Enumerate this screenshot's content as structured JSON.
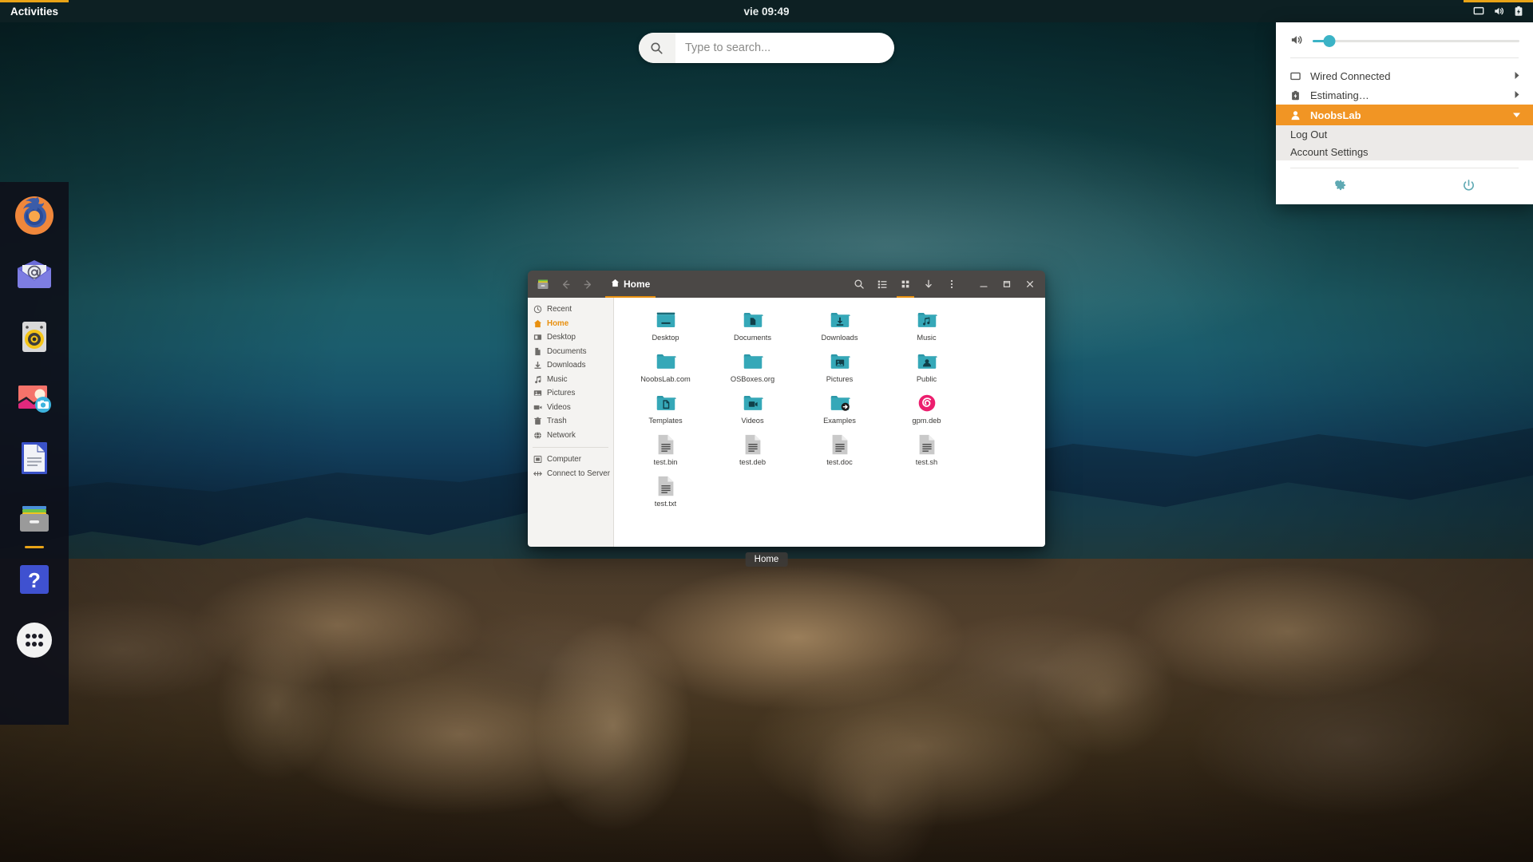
{
  "topbar": {
    "activities_label": "Activities",
    "clock": "vie 09:49",
    "status_icons": [
      "display-icon",
      "volume-icon",
      "battery-icon"
    ]
  },
  "search": {
    "placeholder": "Type to search...",
    "value": "",
    "icon": "search-icon"
  },
  "dock": {
    "items": [
      {
        "name": "firefox",
        "label": "Firefox",
        "running": false
      },
      {
        "name": "thunderbird",
        "label": "Thunderbird Mail",
        "running": false
      },
      {
        "name": "rhythmbox",
        "label": "Rhythmbox",
        "running": false
      },
      {
        "name": "shotwell",
        "label": "Shotwell Photo Manager",
        "running": false
      },
      {
        "name": "libreoffice-writer",
        "label": "LibreOffice Writer",
        "running": false
      },
      {
        "name": "files",
        "label": "Files",
        "running": true
      },
      {
        "name": "help",
        "label": "Help",
        "running": false
      },
      {
        "name": "show-applications",
        "label": "Show Applications",
        "running": false
      }
    ]
  },
  "filemanager": {
    "title": "Home",
    "breadcrumb": "Home",
    "tooltip": "Home",
    "header_buttons": [
      {
        "name": "back",
        "icon": "arrow-left-icon",
        "disabled": true
      },
      {
        "name": "forward",
        "icon": "arrow-right-icon",
        "disabled": true
      }
    ],
    "action_buttons": [
      {
        "name": "search",
        "icon": "search-icon",
        "active": false
      },
      {
        "name": "list-view",
        "icon": "list-view-icon",
        "active": false
      },
      {
        "name": "grid-view",
        "icon": "grid-view-icon",
        "active": true
      },
      {
        "name": "downloads",
        "icon": "arrow-down-icon",
        "active": false
      },
      {
        "name": "menu",
        "icon": "kebab-menu-icon",
        "active": false
      }
    ],
    "window_controls": [
      {
        "name": "minimize",
        "icon": "minimize-icon"
      },
      {
        "name": "maximize",
        "icon": "maximize-icon"
      },
      {
        "name": "close",
        "icon": "close-icon"
      }
    ],
    "sidebar": {
      "places": [
        {
          "label": "Recent",
          "icon": "clock-icon",
          "selected": false
        },
        {
          "label": "Home",
          "icon": "home-icon",
          "selected": true
        },
        {
          "label": "Desktop",
          "icon": "desktop-icon",
          "selected": false
        },
        {
          "label": "Documents",
          "icon": "document-icon",
          "selected": false
        },
        {
          "label": "Downloads",
          "icon": "download-icon",
          "selected": false
        },
        {
          "label": "Music",
          "icon": "music-icon",
          "selected": false
        },
        {
          "label": "Pictures",
          "icon": "picture-icon",
          "selected": false
        },
        {
          "label": "Videos",
          "icon": "video-icon",
          "selected": false
        },
        {
          "label": "Trash",
          "icon": "trash-icon",
          "selected": false
        },
        {
          "label": "Network",
          "icon": "network-icon",
          "selected": false
        }
      ],
      "devices": [
        {
          "label": "Computer",
          "icon": "computer-icon"
        },
        {
          "label": "Connect to Server",
          "icon": "connect-server-icon"
        }
      ]
    },
    "files": [
      {
        "label": "Desktop",
        "type": "folder",
        "glyph": "desktop"
      },
      {
        "label": "Documents",
        "type": "folder",
        "glyph": "document"
      },
      {
        "label": "Downloads",
        "type": "folder",
        "glyph": "download"
      },
      {
        "label": "Music",
        "type": "folder",
        "glyph": "music"
      },
      {
        "label": "NoobsLab.com",
        "type": "folder",
        "glyph": "none"
      },
      {
        "label": "OSBoxes.org",
        "type": "folder",
        "glyph": "none"
      },
      {
        "label": "Pictures",
        "type": "folder",
        "glyph": "picture"
      },
      {
        "label": "Public",
        "type": "folder",
        "glyph": "person"
      },
      {
        "label": "Templates",
        "type": "folder",
        "glyph": "template"
      },
      {
        "label": "Videos",
        "type": "folder",
        "glyph": "video"
      },
      {
        "label": "Examples",
        "type": "folder-link",
        "glyph": "none"
      },
      {
        "label": "gpm.deb",
        "type": "debian",
        "glyph": "none"
      },
      {
        "label": "test.bin",
        "type": "file",
        "glyph": "none"
      },
      {
        "label": "test.deb",
        "type": "file",
        "glyph": "none"
      },
      {
        "label": "test.doc",
        "type": "file",
        "glyph": "none"
      },
      {
        "label": "test.sh",
        "type": "file",
        "glyph": "none"
      },
      {
        "label": "test.txt",
        "type": "file",
        "glyph": "none"
      }
    ]
  },
  "system_menu": {
    "volume": {
      "icon": "volume-icon",
      "value": 8
    },
    "rows": [
      {
        "label": "Wired Connected",
        "icon": "wired-icon",
        "expand": true,
        "highlight": false
      },
      {
        "label": "Estimating…",
        "icon": "battery-icon",
        "expand": true,
        "highlight": false
      },
      {
        "label": "NoobsLab",
        "icon": "user-icon",
        "expand": true,
        "highlight": true
      }
    ],
    "submenu": [
      {
        "label": "Log Out"
      },
      {
        "label": "Account Settings"
      }
    ],
    "footer": [
      {
        "name": "settings",
        "icon": "gear-icon"
      },
      {
        "name": "power",
        "icon": "power-icon"
      }
    ]
  },
  "colors": {
    "accent_orange": "#e8a317",
    "highlight_orange": "#f19524",
    "teal": "#3bb3c6",
    "folder_teal": "#35a8b8",
    "topbar_bg": "#0d2023",
    "window_header": "#4b4846"
  }
}
